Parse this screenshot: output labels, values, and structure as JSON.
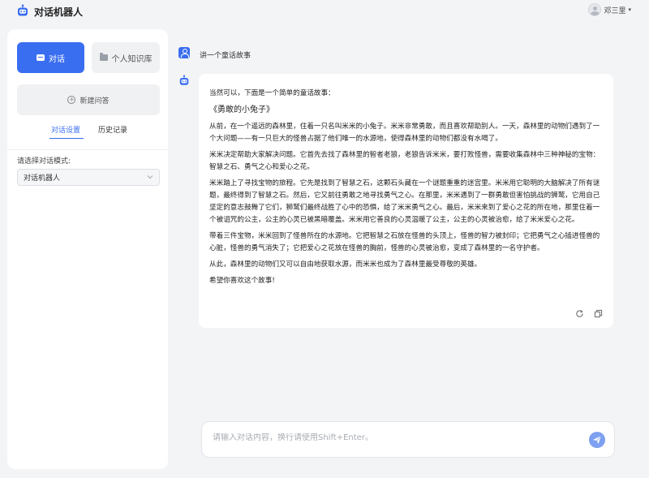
{
  "header": {
    "app_title": "对话机器人",
    "user_name": "邓三里",
    "user_caret": "▾"
  },
  "sidebar": {
    "chat_button": "对话",
    "knowledge_button": "个人知识库",
    "new_chat_button": "新建问答",
    "tabs": [
      {
        "label": "对话设置",
        "active": true
      },
      {
        "label": "历史记录",
        "active": false
      }
    ],
    "mode_label": "请选择对话模式:",
    "mode_selected": "对话机器人"
  },
  "chat": {
    "user_message": "讲一个童话故事",
    "answer": {
      "intro": "当然可以，下面是一个简单的童话故事：",
      "story_title": "《勇敢的小兔子》",
      "paragraphs": [
        "从前，在一个遥远的森林里，住着一只名叫米米的小兔子。米米非常勇敢，而且喜欢帮助别人。一天，森林里的动物们遇到了一个大问题——有一只巨大的怪兽占据了他们唯一的水源地，使得森林里的动物们都没有水喝了。",
        "米米决定帮助大家解决问题。它首先去找了森林里的智者老狼，老狼告诉米米，要打败怪兽，需要收集森林中三种神秘的宝物：智慧之石、勇气之心和爱心之花。",
        "米米踏上了寻找宝物的旅程。它先是找到了智慧之石，这颗石头藏在一个谜题重重的迷宫里。米米用它聪明的大脑解决了所有谜题，最终得到了智慧之石。然后，它又前往勇敢之地寻找勇气之心。在那里，米米遇到了一群勇敢但害怕挑战的狮鹫，它用自己坚定的意志鼓舞了它们，狮鹫们最终战胜了心中的恐惧，给了米米勇气之心。最后，米米来到了爱心之花的所在地，那里住着一个被诅咒的公主，公主的心灵已被黑暗覆盖。米米用它善良的心灵温暖了公主，公主的心灵被治愈，给了米米爱心之花。",
        "带着三件宝物，米米回到了怪兽所在的水源地。它把智慧之石放在怪兽的头顶上，怪兽的智力被封印；它把勇气之心插进怪兽的心脏，怪兽的勇气消失了；它把爱心之花放在怪兽的胸前，怪兽的心灵被治愈，变成了森林里的一名守护者。",
        "从此，森林里的动物们又可以自由地获取水源，而米米也成为了森林里最受尊敬的英雄。",
        "希望你喜欢这个故事!"
      ]
    }
  },
  "input": {
    "placeholder": "请输入对话内容，换行请使用Shift+Enter。",
    "value": ""
  },
  "colors": {
    "accent": "#3a6ef1",
    "send_button": "#7ea0f0",
    "background": "#f3f4f6"
  },
  "icons": [
    "robot-logo-icon",
    "chat-icon",
    "folder-icon",
    "plus-circle-icon",
    "chevron-down-icon",
    "user-icon",
    "refresh-icon",
    "copy-icon",
    "send-icon"
  ]
}
